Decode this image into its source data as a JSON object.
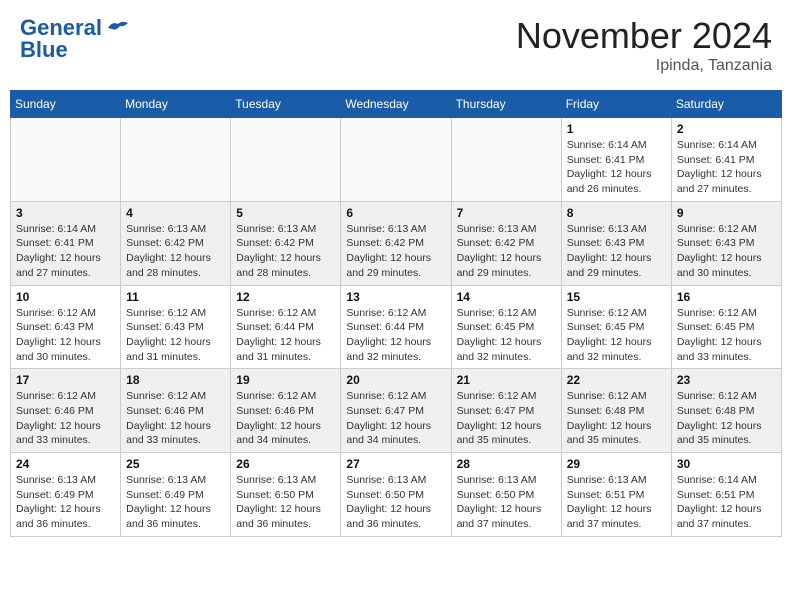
{
  "header": {
    "logo_line1": "General",
    "logo_line2": "Blue",
    "month_title": "November 2024",
    "location": "Ipinda, Tanzania"
  },
  "days_of_week": [
    "Sunday",
    "Monday",
    "Tuesday",
    "Wednesday",
    "Thursday",
    "Friday",
    "Saturday"
  ],
  "weeks": [
    [
      {
        "day": "",
        "info": ""
      },
      {
        "day": "",
        "info": ""
      },
      {
        "day": "",
        "info": ""
      },
      {
        "day": "",
        "info": ""
      },
      {
        "day": "",
        "info": ""
      },
      {
        "day": "1",
        "info": "Sunrise: 6:14 AM\nSunset: 6:41 PM\nDaylight: 12 hours\nand 26 minutes."
      },
      {
        "day": "2",
        "info": "Sunrise: 6:14 AM\nSunset: 6:41 PM\nDaylight: 12 hours\nand 27 minutes."
      }
    ],
    [
      {
        "day": "3",
        "info": "Sunrise: 6:14 AM\nSunset: 6:41 PM\nDaylight: 12 hours\nand 27 minutes."
      },
      {
        "day": "4",
        "info": "Sunrise: 6:13 AM\nSunset: 6:42 PM\nDaylight: 12 hours\nand 28 minutes."
      },
      {
        "day": "5",
        "info": "Sunrise: 6:13 AM\nSunset: 6:42 PM\nDaylight: 12 hours\nand 28 minutes."
      },
      {
        "day": "6",
        "info": "Sunrise: 6:13 AM\nSunset: 6:42 PM\nDaylight: 12 hours\nand 29 minutes."
      },
      {
        "day": "7",
        "info": "Sunrise: 6:13 AM\nSunset: 6:42 PM\nDaylight: 12 hours\nand 29 minutes."
      },
      {
        "day": "8",
        "info": "Sunrise: 6:13 AM\nSunset: 6:43 PM\nDaylight: 12 hours\nand 29 minutes."
      },
      {
        "day": "9",
        "info": "Sunrise: 6:12 AM\nSunset: 6:43 PM\nDaylight: 12 hours\nand 30 minutes."
      }
    ],
    [
      {
        "day": "10",
        "info": "Sunrise: 6:12 AM\nSunset: 6:43 PM\nDaylight: 12 hours\nand 30 minutes."
      },
      {
        "day": "11",
        "info": "Sunrise: 6:12 AM\nSunset: 6:43 PM\nDaylight: 12 hours\nand 31 minutes."
      },
      {
        "day": "12",
        "info": "Sunrise: 6:12 AM\nSunset: 6:44 PM\nDaylight: 12 hours\nand 31 minutes."
      },
      {
        "day": "13",
        "info": "Sunrise: 6:12 AM\nSunset: 6:44 PM\nDaylight: 12 hours\nand 32 minutes."
      },
      {
        "day": "14",
        "info": "Sunrise: 6:12 AM\nSunset: 6:45 PM\nDaylight: 12 hours\nand 32 minutes."
      },
      {
        "day": "15",
        "info": "Sunrise: 6:12 AM\nSunset: 6:45 PM\nDaylight: 12 hours\nand 32 minutes."
      },
      {
        "day": "16",
        "info": "Sunrise: 6:12 AM\nSunset: 6:45 PM\nDaylight: 12 hours\nand 33 minutes."
      }
    ],
    [
      {
        "day": "17",
        "info": "Sunrise: 6:12 AM\nSunset: 6:46 PM\nDaylight: 12 hours\nand 33 minutes."
      },
      {
        "day": "18",
        "info": "Sunrise: 6:12 AM\nSunset: 6:46 PM\nDaylight: 12 hours\nand 33 minutes."
      },
      {
        "day": "19",
        "info": "Sunrise: 6:12 AM\nSunset: 6:46 PM\nDaylight: 12 hours\nand 34 minutes."
      },
      {
        "day": "20",
        "info": "Sunrise: 6:12 AM\nSunset: 6:47 PM\nDaylight: 12 hours\nand 34 minutes."
      },
      {
        "day": "21",
        "info": "Sunrise: 6:12 AM\nSunset: 6:47 PM\nDaylight: 12 hours\nand 35 minutes."
      },
      {
        "day": "22",
        "info": "Sunrise: 6:12 AM\nSunset: 6:48 PM\nDaylight: 12 hours\nand 35 minutes."
      },
      {
        "day": "23",
        "info": "Sunrise: 6:12 AM\nSunset: 6:48 PM\nDaylight: 12 hours\nand 35 minutes."
      }
    ],
    [
      {
        "day": "24",
        "info": "Sunrise: 6:13 AM\nSunset: 6:49 PM\nDaylight: 12 hours\nand 36 minutes."
      },
      {
        "day": "25",
        "info": "Sunrise: 6:13 AM\nSunset: 6:49 PM\nDaylight: 12 hours\nand 36 minutes."
      },
      {
        "day": "26",
        "info": "Sunrise: 6:13 AM\nSunset: 6:50 PM\nDaylight: 12 hours\nand 36 minutes."
      },
      {
        "day": "27",
        "info": "Sunrise: 6:13 AM\nSunset: 6:50 PM\nDaylight: 12 hours\nand 36 minutes."
      },
      {
        "day": "28",
        "info": "Sunrise: 6:13 AM\nSunset: 6:50 PM\nDaylight: 12 hours\nand 37 minutes."
      },
      {
        "day": "29",
        "info": "Sunrise: 6:13 AM\nSunset: 6:51 PM\nDaylight: 12 hours\nand 37 minutes."
      },
      {
        "day": "30",
        "info": "Sunrise: 6:14 AM\nSunset: 6:51 PM\nDaylight: 12 hours\nand 37 minutes."
      }
    ]
  ]
}
